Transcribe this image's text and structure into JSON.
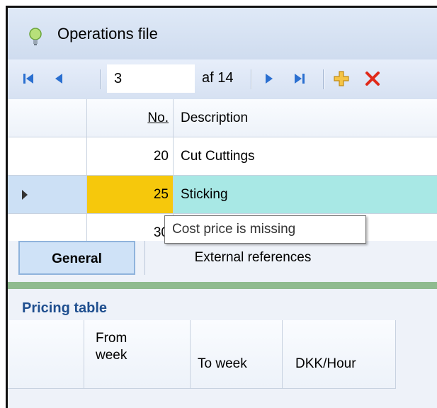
{
  "window": {
    "title": "Operations file",
    "icon": "lightbulb-icon"
  },
  "navigator": {
    "position": "3",
    "of_label": "af 14",
    "buttons": [
      "first-record-icon",
      "previous-record-icon",
      "next-record-icon",
      "last-record-icon",
      "add-icon",
      "delete-icon"
    ]
  },
  "grid": {
    "columns": {
      "no": "No.",
      "description": "Description"
    },
    "rows": [
      {
        "no": "20",
        "description": "Cut Cuttings"
      },
      {
        "no": "25",
        "description": "Sticking",
        "selected": true,
        "flag_color": "#f6c80c"
      },
      {
        "no": "30",
        "description": ""
      }
    ]
  },
  "tooltip": {
    "text": "Cost price is missing"
  },
  "tabs": [
    {
      "label": "General",
      "active": true
    },
    {
      "label": "External references",
      "active": false
    }
  ],
  "pricing": {
    "title": "Pricing table",
    "columns": [
      "From\nweek",
      "To week",
      "DKK/Hour"
    ]
  },
  "colors": {
    "selected_row": "#a8e8e5",
    "warning_cell": "#f6c80c",
    "accent_bar": "#8fbb8f"
  }
}
